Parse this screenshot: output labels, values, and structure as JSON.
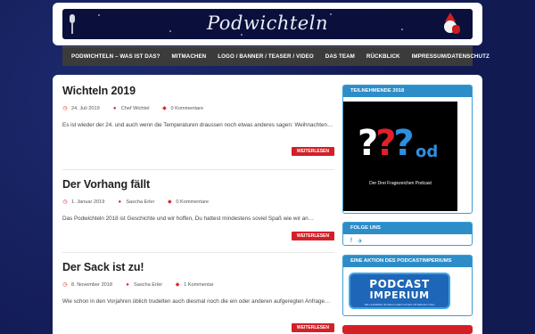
{
  "header": {
    "site_title": "Podwichteln",
    "icons": [
      "microphone-icon",
      "santa-icon"
    ]
  },
  "nav": {
    "items": [
      "PODWICHTELN – WAS IST DAS?",
      "MITMACHEN",
      "LOGO / BANNER / TEASER / VIDEO",
      "DAS TEAM",
      "RÜCKBLICK",
      "IMPRESSUM/DATENSCHUTZ"
    ]
  },
  "posts": [
    {
      "title": "Wichteln 2019",
      "date": "24. Juli 2019",
      "author": "Chef Wichtel",
      "comments": "0 Kommentare",
      "excerpt": "Es ist wieder der 24. und auch wenn die Temperaturen draussen noch etwas anderes sagen: Weihnachten…",
      "read_more": "WEITERLESEN"
    },
    {
      "title": "Der Vorhang fällt",
      "date": "1. Januar 2019",
      "author": "Sascha Erler",
      "comments": "0 Kommentare",
      "excerpt": "Das Podwichteln 2018 ist Geschichte und wir hoffen, Du hattest mindestens soviel Spaß wie wir an…",
      "read_more": "WEITERLESEN"
    },
    {
      "title": "Der Sack ist zu!",
      "date": "8. November 2018",
      "author": "Sascha Erler",
      "comments": "1 Kommentar",
      "excerpt": "Wie schon in den Vorjahren üblich trudelten auch diesmal noch die ein oder anderen aufgeregten Anfrage…",
      "read_more": "WEITERLESEN"
    }
  ],
  "sidebar": {
    "participants_title": "TEILNEHMENDE 2018",
    "podcast_logo": {
      "q1": "?",
      "q2": "?",
      "q3": "?",
      "suffix": "od",
      "caption": "Der Drei Fragezeichen Podcast"
    },
    "follow_title": "FOLGE UNS",
    "social_icons": [
      "facebook-icon",
      "twitter-icon"
    ],
    "action_title": "EINE AKTION DES PODCASTIMPERIUMS",
    "imperium_logo": {
      "line1": "PODCAST",
      "line2": "IMPERIUM",
      "tagline": "WILLKOMMEN IM REICH DER GUTEN UNTERHALTUNG"
    }
  },
  "colors": {
    "background": "#121a52",
    "accent_red": "#d32027",
    "accent_blue": "#2c8dc8",
    "nav_bg": "#3b3b3b"
  }
}
